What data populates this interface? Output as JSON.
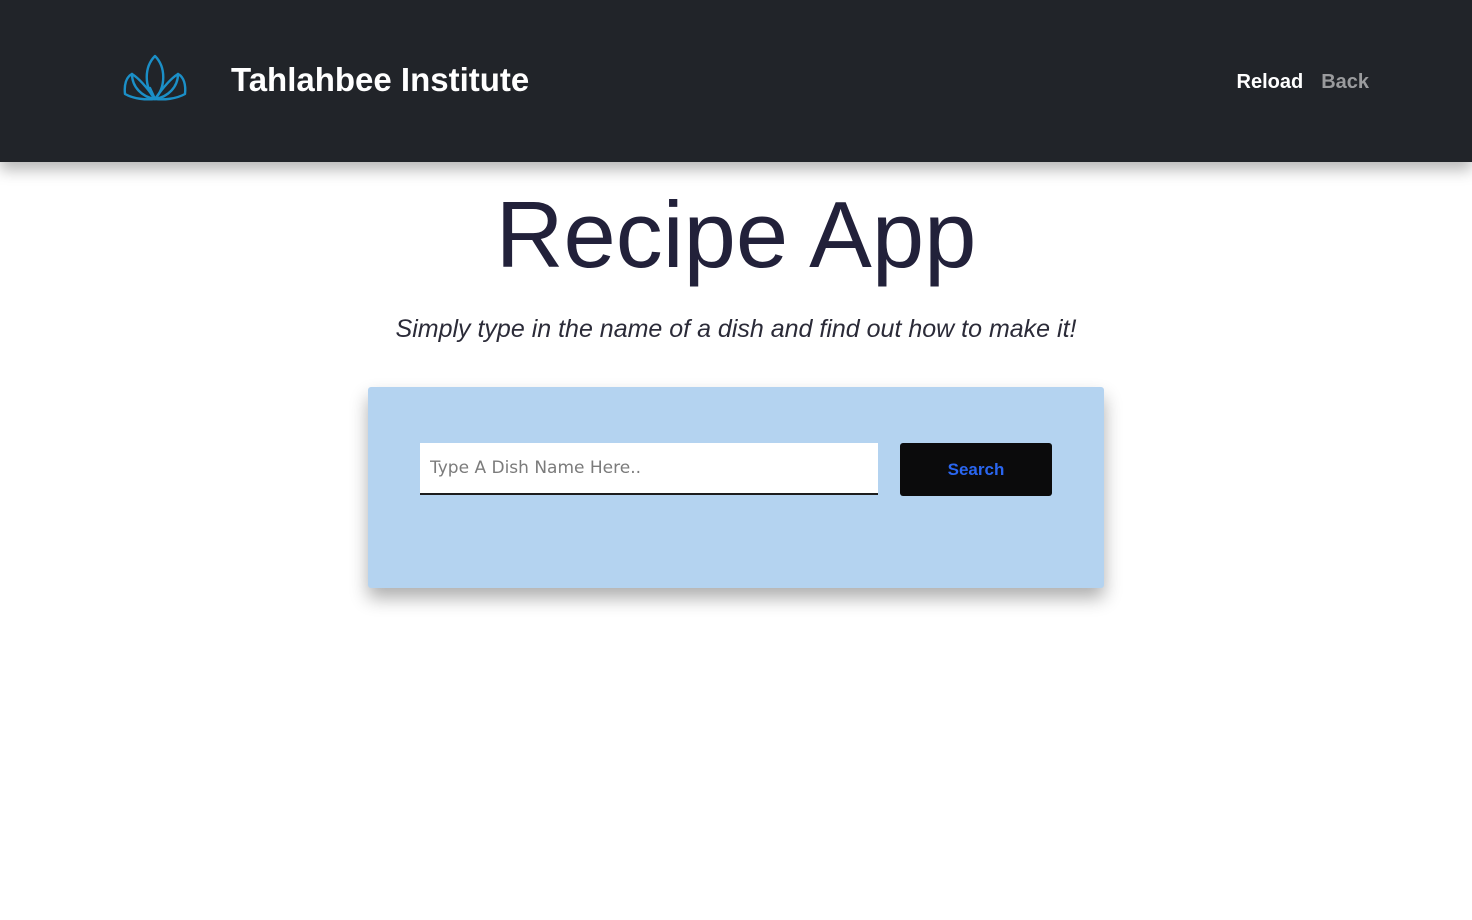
{
  "navbar": {
    "brand_name": "Tahlahbee Institute",
    "logo_icon": "lotus-icon",
    "logo_color": "#1b8fc7",
    "links": {
      "reload": "Reload",
      "back": "Back"
    },
    "background": "#212429"
  },
  "main": {
    "title": "Recipe App",
    "subtitle": "Simply type in the name of a dish and find out how to make it!",
    "search": {
      "placeholder": "Type A Dish Name Here..",
      "value": "",
      "button_label": "Search"
    },
    "card_color": "#b4d3f0",
    "button_text_color": "#2a66f0"
  }
}
